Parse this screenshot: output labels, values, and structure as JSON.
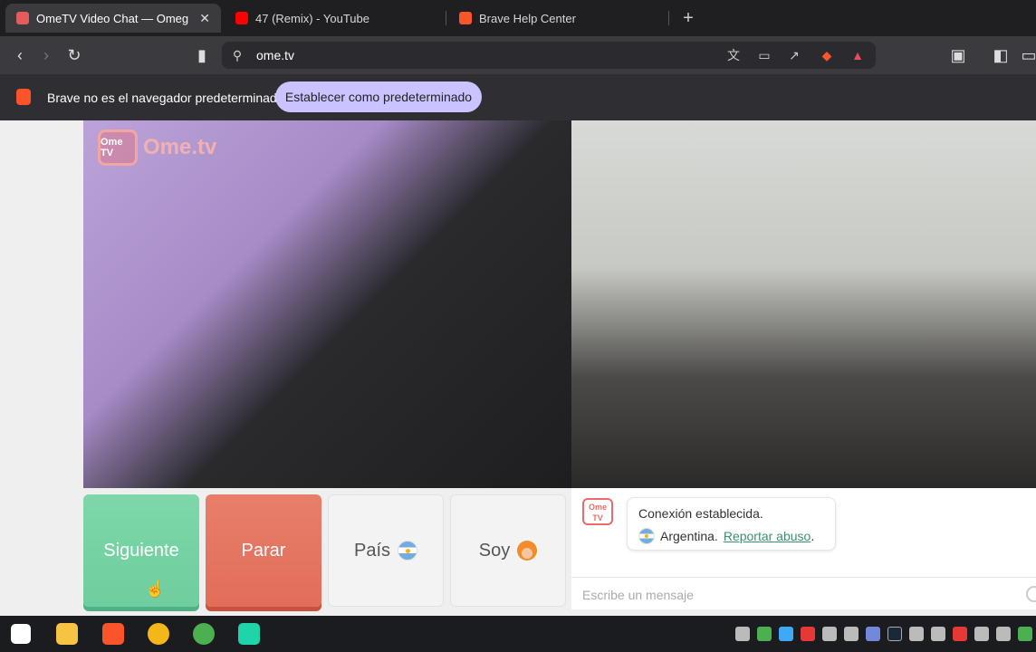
{
  "tabs": [
    {
      "title": "OmeTV Video Chat — Omeg",
      "close": "✕"
    },
    {
      "title": "47 (Remix) - YouTube"
    },
    {
      "title": "Brave Help Center"
    }
  ],
  "toolbar": {
    "url": "ome.tv"
  },
  "infobar": {
    "message": "Brave no es el navegador predeterminado",
    "button": "Establecer como predeterminado"
  },
  "logo": {
    "badge": "Ome TV",
    "text": "Ome.tv"
  },
  "controls": {
    "next": "Siguiente",
    "stop": "Parar",
    "country": "País",
    "gender": "Soy"
  },
  "chat": {
    "logo": "Ome TV",
    "status": "Conexión establecida.",
    "country": "Argentina.",
    "report": "Reportar abuso",
    "report_suffix": ".",
    "placeholder": "Escribe un mensaje"
  },
  "colors": {
    "next": "#6fcd9e",
    "stop": "#e16e59",
    "link": "#3d8f6e",
    "infobar_button": "#c9c4ff"
  }
}
